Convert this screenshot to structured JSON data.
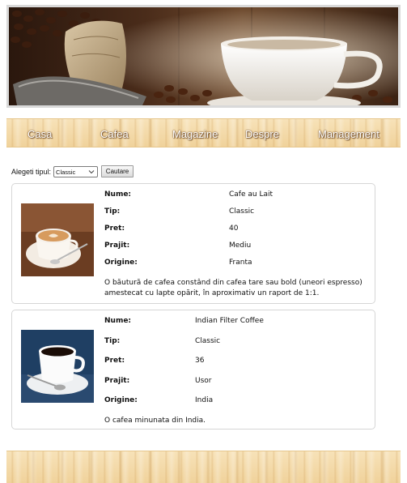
{
  "nav": {
    "items": [
      "Casa",
      "Cafea",
      "Magazine",
      "Despre",
      "Management"
    ]
  },
  "filter": {
    "label": "Alegeti tipul:",
    "selected": "Classic",
    "button": "Cautare"
  },
  "labels": {
    "name": "Nume:",
    "type": "Tip:",
    "price": "Pret:",
    "roast": "Prajit:",
    "origin": "Origine:"
  },
  "products": [
    {
      "name": "Cafe au Lait",
      "type": "Classic",
      "price": "40",
      "roast": "Mediu",
      "origin": "Franta",
      "description": "O băutură de cafea constând din cafea tare sau bold (uneori espresso) amestecat cu lapte opărit, în aproximativ un raport de 1:1."
    },
    {
      "name": "Indian Filter Coffee",
      "type": "Classic",
      "price": "36",
      "roast": "Usor",
      "origin": "India",
      "description": "O cafea minunata din India."
    }
  ],
  "colors": {
    "wood": "#f3d9a6",
    "card_border": "#d6d6d6",
    "banner_border": "#d9d9d9"
  }
}
